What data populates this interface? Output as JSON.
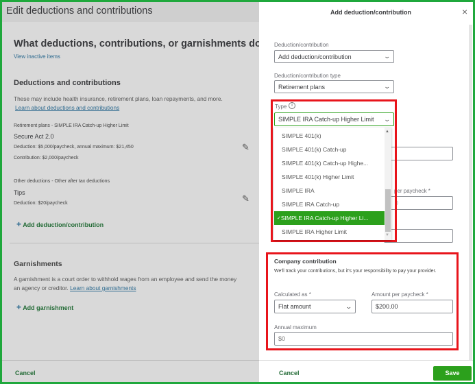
{
  "left": {
    "header_title": "Edit deductions and contributions",
    "question": "What deductions, contributions, or garnishments does Jeff",
    "view_inactive": "View inactive items",
    "deductions_heading": "Deductions and contributions",
    "deductions_desc": "These may include health insurance, retirement plans, loan repayments, and more.",
    "deductions_link": "Learn about deductions and contributions",
    "items": [
      {
        "category": "Retirement plans - SIMPLE IRA Catch-up Higher Limit",
        "name": "Secure Act 2.0",
        "line1": "Deduction: $5,000/paycheck, annual maximum: $21,450",
        "line2": "Contribution: $2,000/paycheck"
      },
      {
        "category": "Other deductions - Other after tax deductions",
        "name": "Tips",
        "line1": "Deduction: $20/paycheck"
      }
    ],
    "add_deduction": "Add deduction/contribution",
    "garnishments_heading": "Garnishments",
    "garnishments_desc1": "A garnishment is a court order to withhold wages from an employee and send the money",
    "garnishments_desc2": "an agency or creditor.",
    "garnishments_link": "Learn about garnishments",
    "add_garnishment": "Add garnishment",
    "cancel": "Cancel"
  },
  "panel": {
    "title": "Add deduction/contribution",
    "deduction_label": "Deduction/contribution",
    "deduction_value": "Add deduction/contribution",
    "type_group_label": "Deduction/contribution type",
    "type_group_value": "Retirement plans",
    "type_label": "Type",
    "type_value": "SIMPLE IRA Catch-up Higher Limit",
    "options": [
      "SIMPLE 401(k)",
      "SIMPLE 401(k) Catch-up",
      "SIMPLE 401(k) Catch-up Highe...",
      "SIMPLE 401(k) Higher Limit",
      "SIMPLE IRA",
      "SIMPLE IRA Catch-up",
      "SIMPLE IRA Catch-up Higher Li...",
      "SIMPLE IRA Higher Limit"
    ],
    "selected_index": 6,
    "hidden_label": "per paycheck *",
    "hidden_value": "0",
    "company": {
      "heading": "Company contribution",
      "desc": "We'll track your contributions, but it's your responsibility to pay your provider.",
      "calc_label": "Calculated as *",
      "calc_value": "Flat amount",
      "amount_label": "Amount per paycheck *",
      "amount_value": "$200.00",
      "annual_label": "Annual maximum",
      "annual_value": "$0"
    },
    "cancel": "Cancel",
    "save": "Save"
  }
}
